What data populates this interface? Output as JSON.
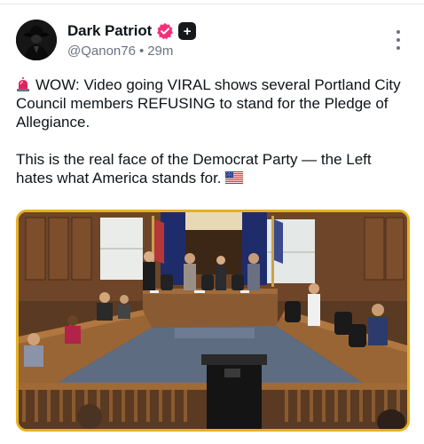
{
  "post": {
    "author": {
      "display_name": "Dark Patriot",
      "handle": "@Qanon76",
      "separator": "•",
      "time": "29m",
      "verified_icon": "verified-badge-icon",
      "subscriber_badge": "+",
      "avatar_icon": "avatar-figure-icon"
    },
    "more_icon": "more-vertical-icon",
    "paragraphs": [
      "WOW: Video going VIRAL shows several Portland City Council members REFUSING to stand for the Pledge of Allegiance.",
      "This is the real face of the Democrat Party — the Left hates what America stands for."
    ],
    "emoji_lead": "siren-emoji-icon",
    "emoji_trail": "us-flag-emoji-icon",
    "media": {
      "type": "video-still",
      "description_icon": "council-chamber-image"
    }
  },
  "colors": {
    "badge_pink": "#f4307a",
    "frame_gold": "#e6b122",
    "frame_blue": "#3b66c4",
    "meta_gray": "#6b7280"
  }
}
